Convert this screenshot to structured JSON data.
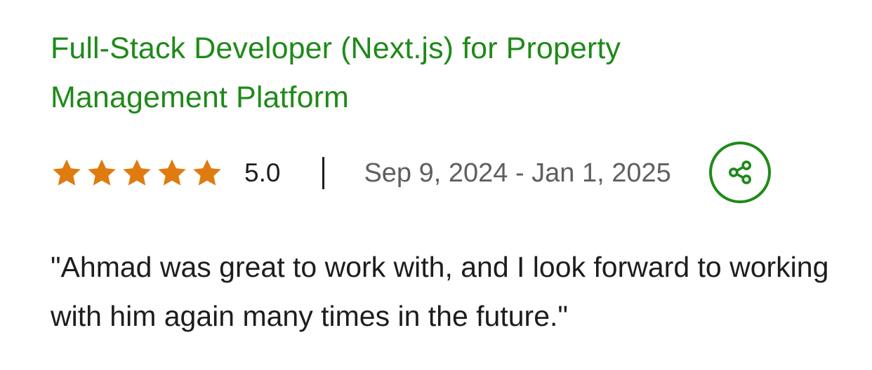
{
  "job": {
    "title": "Full-Stack Developer (Next.js) for Property Management Platform"
  },
  "rating": {
    "value": "5.0",
    "stars": 5,
    "max_stars": 5,
    "star_icon": "star-icon",
    "star_color": "#e07b10"
  },
  "date_range": "Sep 9, 2024 - Jan 1, 2025",
  "share": {
    "icon": "share-icon"
  },
  "review": {
    "text": "\"Ahmad was great to work with, and I look forward to working with him again many times in the future.\""
  },
  "colors": {
    "accent": "#1f8a19",
    "text": "#1d1d1d",
    "muted": "#5f5f5f"
  }
}
